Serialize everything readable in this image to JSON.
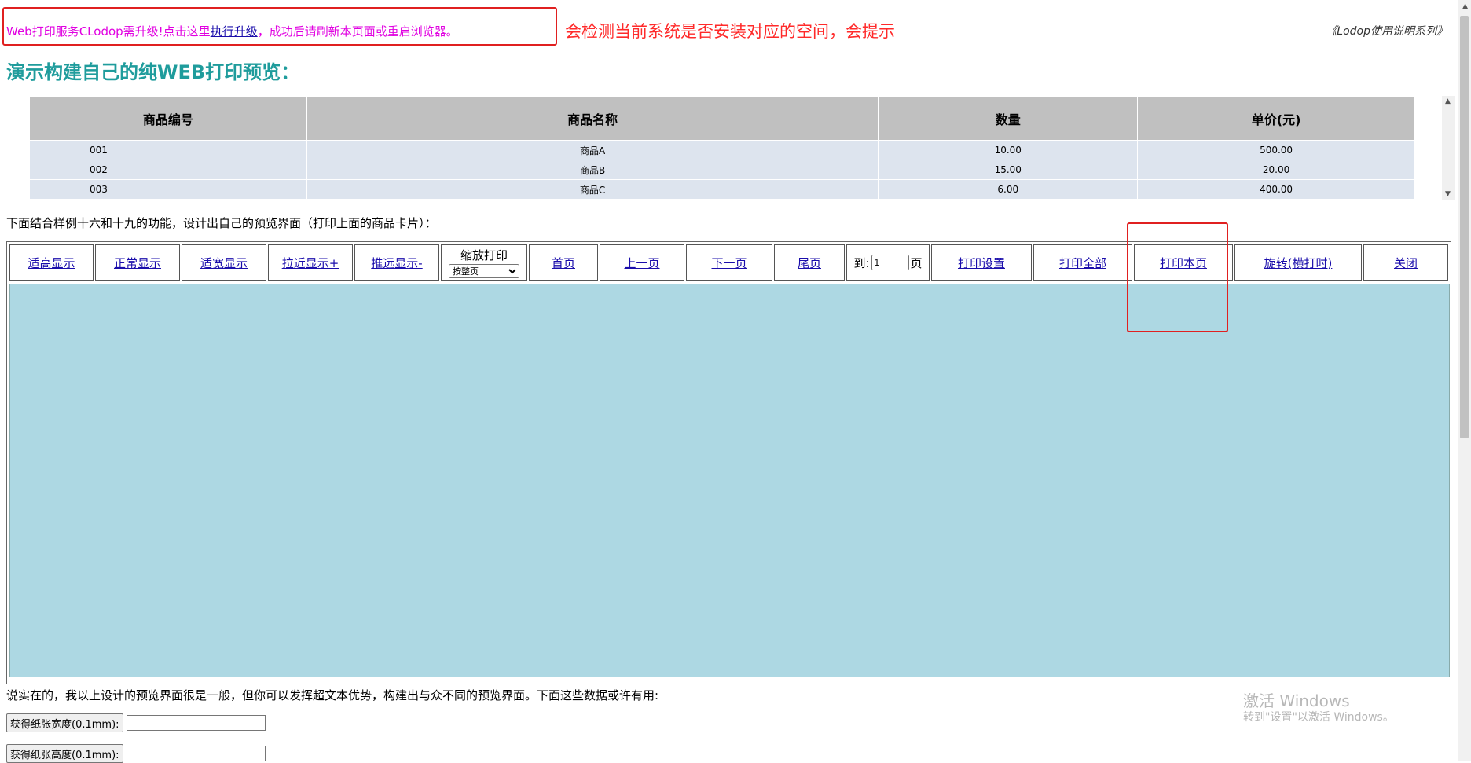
{
  "notice": {
    "prefix": "Web打印服务CLodop需升级!点击这里",
    "link": "执行升级",
    "suffix": "，成功后请刷新本页面或重启浏览器。"
  },
  "annotation_top": "会检测当前系统是否安装对应的空间，会提示",
  "series_link": "《Lodop使用说明系列》",
  "page_title": "演示构建自己的纯WEB打印预览：",
  "table": {
    "headers": [
      "商品编号",
      "商品名称",
      "数量",
      "单价(元)"
    ],
    "rows": [
      [
        "001",
        "商品A",
        "10.00",
        "500.00"
      ],
      [
        "002",
        "商品B",
        "15.00",
        "20.00"
      ],
      [
        "003",
        "商品C",
        "6.00",
        "400.00"
      ]
    ]
  },
  "intro_text": "下面结合样例十六和十九的功能，设计出自己的预览界面（打印上面的商品卡片）：",
  "toolbar": {
    "fit_display": "适高显示",
    "normal_display": "正常显示",
    "fit_width": "适宽显示",
    "zoom_in": "拉近显示+",
    "zoom_out": "推远显示-",
    "zoom_print_label": "缩放打印",
    "zoom_print_selected": "按整页",
    "first_page": "首页",
    "prev_page": "上一页",
    "next_page": "下一页",
    "last_page": "尾页",
    "goto_prefix": "到:",
    "goto_value": "1",
    "goto_suffix": "页",
    "print_setup": "打印设置",
    "print_all": "打印全部",
    "print_this_page": "打印本页",
    "rotate": "旋转(横打时)",
    "close": "关闭"
  },
  "bottom_text": "说实在的，我以上设计的预览界面很是一般，但你可以发挥超文本优势，构建出与众不同的预览界面。下面这些数据或许有用:",
  "buttons": {
    "get_width": "获得纸张宽度(0.1mm):",
    "get_height": "获得纸张高度(0.1mm):"
  },
  "watermark": {
    "line1": "激活 Windows",
    "line2": "转到\"设置\"以激活 Windows。"
  },
  "colors": {
    "accent_title": "#1f9c9c",
    "notice_text": "#e100e1",
    "annotation_red": "#ff2a2a",
    "preview_bg": "#add8e3"
  }
}
